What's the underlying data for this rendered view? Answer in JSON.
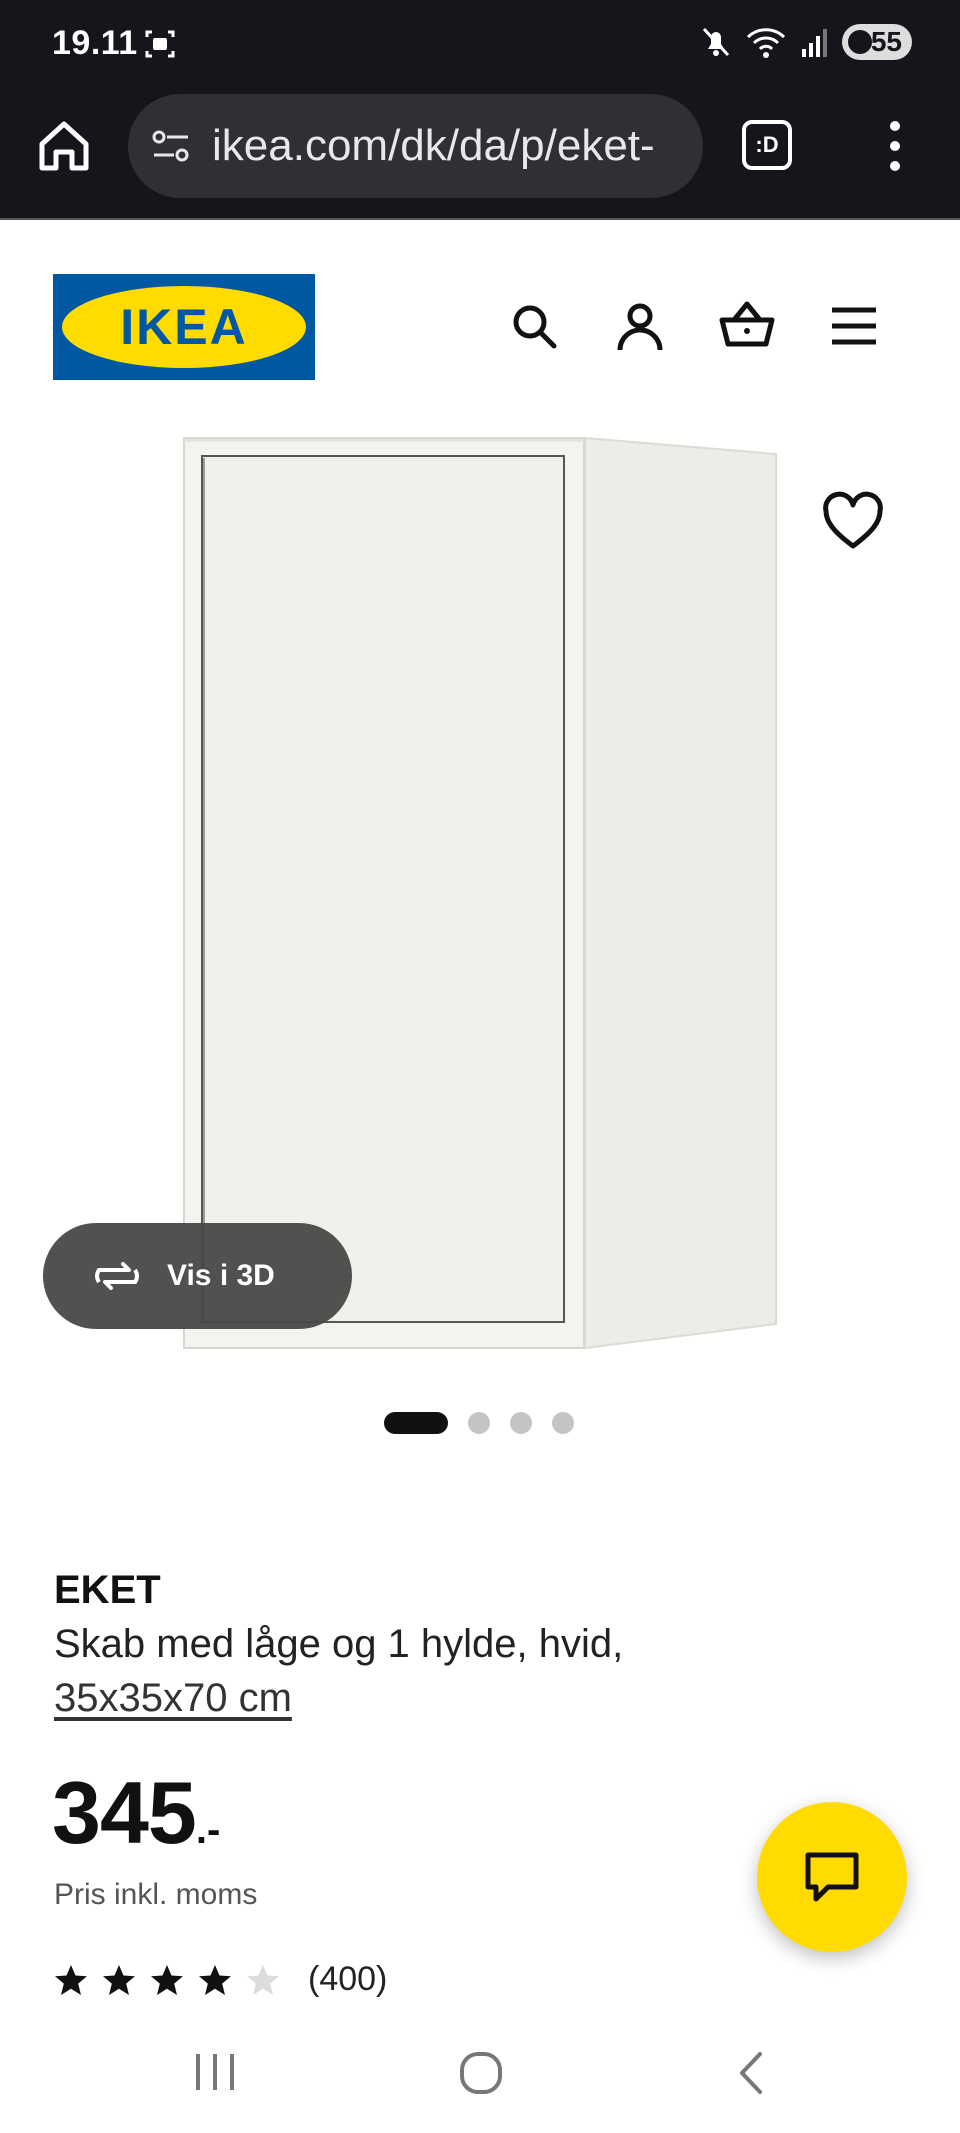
{
  "status_bar": {
    "time": "19.11",
    "battery": "55",
    "icons": [
      "screenshot-icon",
      "mute-icon",
      "wifi-icon",
      "signal-icon",
      "battery-icon"
    ]
  },
  "browser": {
    "url": "ikea.com/dk/da/p/eket-",
    "reader_label": ":D",
    "icons": [
      "home-icon",
      "site-settings-icon",
      "reader-mode-icon",
      "more-vert-icon"
    ]
  },
  "header": {
    "logo_text": "IKEA",
    "icons": [
      "search-icon",
      "account-icon",
      "basket-icon",
      "hamburger-menu-icon"
    ],
    "colors": {
      "logo_blue": "#0058a3",
      "logo_yellow": "#ffdb00"
    }
  },
  "gallery": {
    "vis3d_label": "Vis i 3D",
    "image_count": 4,
    "active_image": 1
  },
  "product": {
    "name": "EKET",
    "description": "Skab med låge og 1 hylde, hvid,",
    "size": "35x35x70 cm",
    "price_main": "345",
    "price_suffix": ".-",
    "price_note": "Pris inkl. moms",
    "rating": 4,
    "rating_max": 5,
    "reviews": "(400)"
  },
  "chat": {
    "icon": "chat-icon",
    "color": "#ffdb00"
  },
  "nav": {
    "icons": [
      "recent-apps-icon",
      "home-circle-icon",
      "back-icon"
    ]
  }
}
